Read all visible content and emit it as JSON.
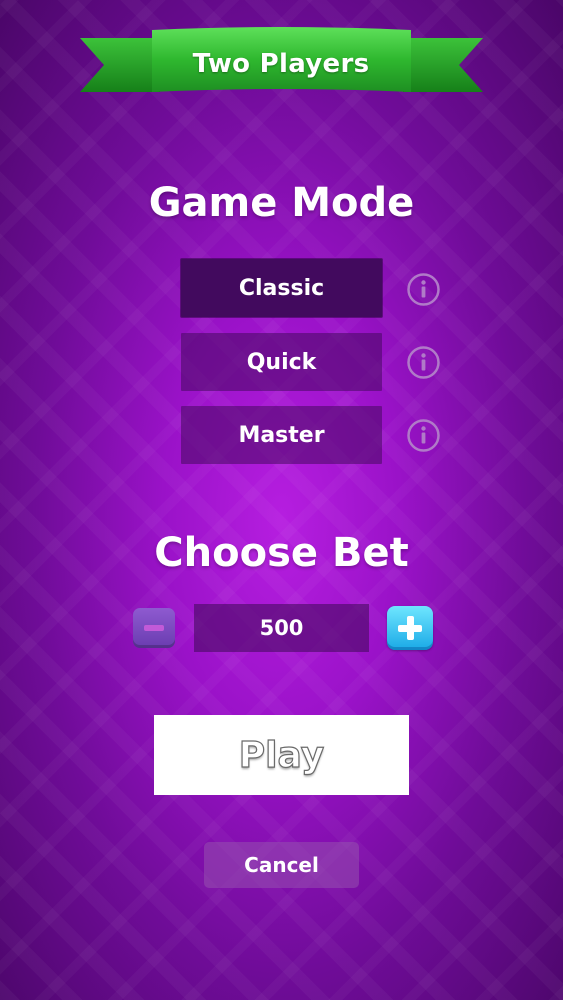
{
  "header": {
    "title": "Two Players"
  },
  "game_mode": {
    "heading": "Game Mode",
    "selected": "Classic",
    "options": [
      {
        "label": "Classic"
      },
      {
        "label": "Quick"
      },
      {
        "label": "Master"
      }
    ],
    "info_icon": "info-circle-icon"
  },
  "bet": {
    "heading": "Choose Bet",
    "value": "500",
    "decrease_icon": "minus-icon",
    "increase_icon": "plus-icon"
  },
  "actions": {
    "play_label": "Play",
    "cancel_label": "Cancel"
  },
  "colors": {
    "background": "#9a12c8",
    "ribbon": "#2fb82f",
    "plus_button": "#1aa9e6",
    "minus_button": "#7a48c0"
  }
}
